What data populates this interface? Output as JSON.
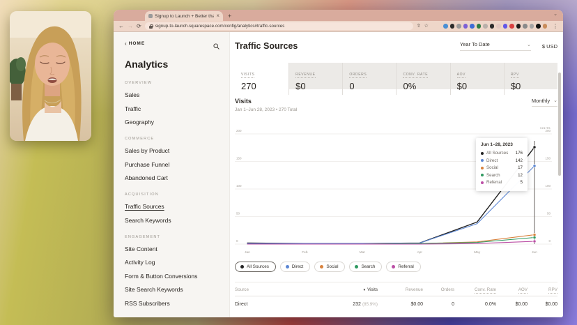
{
  "browser": {
    "tab_title": "Signup to Launch + Better tha",
    "url": "signup-to-launch.squarespace.com/config/analytics#traffic-sources",
    "icons": {
      "back": "←",
      "forward": "→",
      "reload": "⟳",
      "close_tab": "×",
      "new_tab": "+",
      "tab_chevron": "⌄",
      "share": "⇧",
      "star": "☆",
      "menu": "⋮"
    },
    "extensions": [
      "#4a8fd4",
      "#2b2b2b",
      "#9a9a9a",
      "#7b5fd6",
      "#3c6bd6",
      "#2e7d43",
      "#b9b0aa",
      "#2b2b2b",
      "#e3c9c2",
      "#6257e8",
      "#d94040",
      "#1c1c1c",
      "#8a8a8a",
      "#a5a5a5",
      "#111111",
      "#c98c5a"
    ]
  },
  "sidebar": {
    "back_chevron": "‹",
    "home": "HOME",
    "title": "Analytics",
    "sections": [
      {
        "label": "OVERVIEW",
        "items": [
          {
            "label": "Sales"
          },
          {
            "label": "Traffic"
          },
          {
            "label": "Geography"
          }
        ]
      },
      {
        "label": "COMMERCE",
        "items": [
          {
            "label": "Sales by Product"
          },
          {
            "label": "Purchase Funnel"
          },
          {
            "label": "Abandoned Cart"
          }
        ]
      },
      {
        "label": "ACQUISITION",
        "items": [
          {
            "label": "Traffic Sources",
            "active": true
          },
          {
            "label": "Search Keywords"
          }
        ]
      },
      {
        "label": "ENGAGEMENT",
        "items": [
          {
            "label": "Site Content"
          },
          {
            "label": "Activity Log"
          },
          {
            "label": "Form & Button Conversions"
          },
          {
            "label": "Site Search Keywords"
          },
          {
            "label": "RSS Subscribers"
          }
        ]
      }
    ]
  },
  "main": {
    "title": "Traffic Sources",
    "date_range": "Year To Date",
    "currency": "$ USD",
    "chevron": "⌄",
    "stats": [
      {
        "label": "VISITS",
        "value": "270",
        "selected": true
      },
      {
        "label": "REVENUE",
        "value": "$0"
      },
      {
        "label": "ORDERS",
        "value": "0"
      },
      {
        "label": "CONV. RATE",
        "value": "0%"
      },
      {
        "label": "AOV",
        "value": "$0"
      },
      {
        "label": "RPV",
        "value": "$0"
      }
    ],
    "chart_header": {
      "title": "Visits",
      "subtitle": "Jan 1–Jun 28, 2023 • 270 Total",
      "granularity": "Monthly"
    },
    "tooltip": {
      "title": "Jun 1–28, 2023",
      "rows": [
        {
          "name": "All Sources",
          "value": "176",
          "color": "#222222"
        },
        {
          "name": "Direct",
          "value": "142",
          "color": "#5b86d3"
        },
        {
          "name": "Social",
          "value": "17",
          "color": "#d8823d"
        },
        {
          "name": "Search",
          "value": "12",
          "color": "#2f9960"
        },
        {
          "name": "Referral",
          "value": "5",
          "color": "#bb4fa5"
        }
      ]
    },
    "legend": [
      {
        "label": "All Sources",
        "color": "#222222",
        "selected": true
      },
      {
        "label": "Direct",
        "color": "#5b86d3"
      },
      {
        "label": "Social",
        "color": "#d8823d"
      },
      {
        "label": "Search",
        "color": "#2f9960"
      },
      {
        "label": "Referral",
        "color": "#bb4fa5"
      }
    ],
    "table": {
      "sort_indicator": "▼",
      "columns": [
        {
          "label": "Source",
          "align": "left"
        },
        {
          "label": "Visits",
          "align": "right",
          "sorted": true
        },
        {
          "label": "Revenue",
          "align": "right"
        },
        {
          "label": "Orders",
          "align": "right"
        },
        {
          "label": "Conv. Rate",
          "align": "right",
          "hint": true
        },
        {
          "label": "AOV",
          "align": "right",
          "hint": true
        },
        {
          "label": "RPV",
          "align": "right",
          "hint": true
        }
      ],
      "rows": [
        {
          "source": "Direct",
          "visits": "232",
          "visits_share": "(85.9%)",
          "revenue": "$0.00",
          "orders": "0",
          "conv_rate": "0.0%",
          "aov": "$0.00",
          "rpv": "$0.00"
        }
      ]
    }
  },
  "chart_data": {
    "type": "line",
    "title": "Visits",
    "ylabel": "VISITS",
    "ylim": [
      0,
      200
    ],
    "yticks": [
      0,
      50,
      100,
      150,
      200
    ],
    "grid": true,
    "legend_position": "bottom",
    "x": [
      "Jan",
      "Feb",
      "Mar",
      "Apr",
      "May",
      "Jun"
    ],
    "series": [
      {
        "name": "All Sources",
        "color": "#222222",
        "values": [
          2,
          1,
          1,
          2,
          40,
          176
        ]
      },
      {
        "name": "Direct",
        "color": "#5b86d3",
        "values": [
          1,
          1,
          1,
          2,
          37,
          142
        ]
      },
      {
        "name": "Social",
        "color": "#d8823d",
        "values": [
          0,
          0,
          0,
          1,
          4,
          17
        ]
      },
      {
        "name": "Search",
        "color": "#2f9960",
        "values": [
          0,
          0,
          0,
          1,
          3,
          12
        ]
      },
      {
        "name": "Referral",
        "color": "#bb4fa5",
        "values": [
          0,
          0,
          0,
          0,
          1,
          5
        ]
      }
    ],
    "hover_month": "Jun"
  }
}
